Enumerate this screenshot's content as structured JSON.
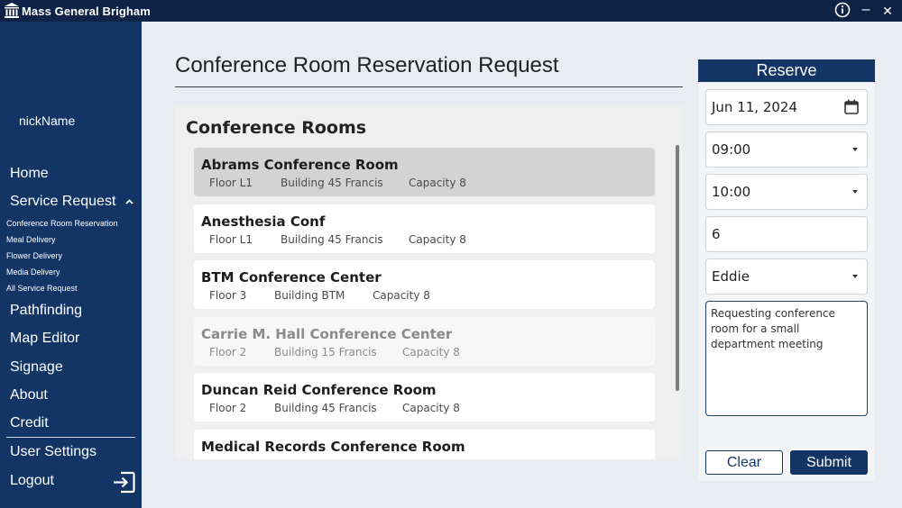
{
  "app": {
    "title": "Mass General Brigham"
  },
  "window_controls": {
    "info_icon": "info-icon",
    "minimize": "–",
    "close": "✕"
  },
  "sidebar": {
    "username": "nickName",
    "nav": {
      "home": "Home",
      "service_request": "Service Request",
      "sub": [
        "Conference Room Reservation",
        "Meal Delivery",
        "Flower Delivery",
        "Media Delivery",
        "All Service Request"
      ],
      "pathfinding": "Pathfinding",
      "map_editor": "Map Editor",
      "signage": "Signage",
      "about": "About",
      "credit": "Credit",
      "user_settings": "User Settings",
      "logout": "Logout"
    }
  },
  "page": {
    "title": "Conference Room Reservation Request"
  },
  "rooms": {
    "title": "Conference Rooms",
    "items": [
      {
        "name": "Abrams Conference Room",
        "floor": "Floor L1",
        "building": "Building 45 Francis",
        "capacity": "Capacity 8"
      },
      {
        "name": "Anesthesia Conf",
        "floor": "Floor L1",
        "building": "Building 45 Francis",
        "capacity": "Capacity 8"
      },
      {
        "name": "BTM Conference Center",
        "floor": "Floor 3",
        "building": "Building BTM",
        "capacity": "Capacity 8"
      },
      {
        "name": "Carrie M. Hall Conference Center",
        "floor": "Floor 2",
        "building": "Building 15 Francis",
        "capacity": "Capacity 8"
      },
      {
        "name": "Duncan Reid Conference Room",
        "floor": "Floor 2",
        "building": "Building 45 Francis",
        "capacity": "Capacity 8"
      },
      {
        "name": "Medical Records Conference Room",
        "floor": "",
        "building": "",
        "capacity": ""
      }
    ]
  },
  "reserve": {
    "title": "Reserve",
    "date": "Jun 11, 2024",
    "start_time": "09:00",
    "end_time": "10:00",
    "attendees": "6",
    "staff": "Eddie",
    "notes": "Requesting conference room for a small department meeting",
    "clear_label": "Clear",
    "submit_label": "Submit"
  },
  "colors": {
    "navy": "#123565",
    "titlebar": "#0f2346",
    "background": "#e9ecf1",
    "selected_row": "#d3d3d3"
  }
}
